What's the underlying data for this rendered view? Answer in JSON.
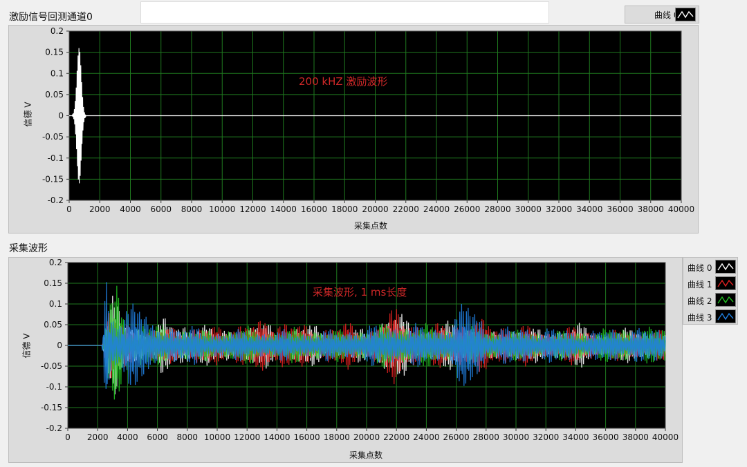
{
  "top_chart": {
    "title": "激励信号回测通道0",
    "ylabel": "信德 V",
    "xlabel": "采集点数",
    "annotation": "200 kHZ 激励波形",
    "legend": [
      {
        "label": "曲线 0",
        "color": "#ffffff"
      }
    ]
  },
  "bottom_chart": {
    "title": "采集波形",
    "ylabel": "信德 V",
    "xlabel": "采集点数",
    "annotation": "采集波形, 1 ms长度",
    "legend": [
      {
        "label": "曲线 0",
        "color": "#ffffff"
      },
      {
        "label": "曲线 1",
        "color": "#e02020"
      },
      {
        "label": "曲线 2",
        "color": "#20c020"
      },
      {
        "label": "曲线 3",
        "color": "#2080e0"
      }
    ]
  },
  "chart_data": [
    {
      "type": "line",
      "title": "激励信号回测通道0",
      "xlabel": "采集点数",
      "ylabel": "信德 V",
      "xlim": [
        0,
        40000
      ],
      "ylim": [
        -0.2,
        0.2
      ],
      "x_ticks": [
        "0",
        "2000",
        "4000",
        "6000",
        "8000",
        "10000",
        "12000",
        "14000",
        "16000",
        "18000",
        "20000",
        "22000",
        "24000",
        "26000",
        "28000",
        "30000",
        "32000",
        "34000",
        "36000",
        "38000",
        "40000"
      ],
      "y_ticks": [
        "0.2",
        "0.15",
        "0.1",
        "0.05",
        "0",
        "-0.05",
        "-0.1",
        "-0.15",
        "-0.2"
      ],
      "grid": true,
      "legend_position": "top-right",
      "series": [
        {
          "name": "曲线 0",
          "color": "#ffffff",
          "burst": {
            "start": 200,
            "end": 1100,
            "peak": 0.185,
            "peak_at": 650
          },
          "after_burst": 0
        }
      ]
    },
    {
      "type": "line",
      "title": "采集波形",
      "xlabel": "采集点数",
      "ylabel": "信德 V",
      "xlim": [
        0,
        40000
      ],
      "ylim": [
        -0.2,
        0.2
      ],
      "x_ticks": [
        "0",
        "2000",
        "4000",
        "6000",
        "8000",
        "10000",
        "12000",
        "14000",
        "16000",
        "18000",
        "20000",
        "22000",
        "24000",
        "26000",
        "28000",
        "30000",
        "32000",
        "34000",
        "36000",
        "38000",
        "40000"
      ],
      "y_ticks": [
        "0.2",
        "0.15",
        "0.1",
        "0.05",
        "0",
        "-0.05",
        "-0.1",
        "-0.15",
        "-0.2"
      ],
      "grid": true,
      "legend_position": "right",
      "signal_start": 2300,
      "series": [
        {
          "name": "曲线 0",
          "color": "#ffffff",
          "envelope": [
            [
              2300,
              0
            ],
            [
              2700,
              0.14
            ],
            [
              3000,
              0.17
            ],
            [
              3600,
              0.06
            ],
            [
              4600,
              0.05
            ],
            [
              5600,
              0.03
            ],
            [
              6300,
              0.08
            ],
            [
              7400,
              0.05
            ],
            [
              8700,
              0.07
            ],
            [
              10000,
              0.04
            ],
            [
              12400,
              0.05
            ],
            [
              13300,
              0.07
            ],
            [
              14000,
              0.03
            ],
            [
              16200,
              0.06
            ],
            [
              18000,
              0.03
            ],
            [
              20000,
              0.05
            ],
            [
              22000,
              0.09
            ],
            [
              24000,
              0.04
            ],
            [
              26000,
              0.07
            ],
            [
              28000,
              0.03
            ],
            [
              30000,
              0.05
            ],
            [
              32000,
              0.04
            ],
            [
              34000,
              0.06
            ],
            [
              36000,
              0.03
            ],
            [
              38000,
              0.05
            ],
            [
              40000,
              0.03
            ]
          ]
        },
        {
          "name": "曲线 1",
          "color": "#e02020",
          "envelope": [
            [
              2300,
              0
            ],
            [
              2800,
              0.1
            ],
            [
              3400,
              0.07
            ],
            [
              5000,
              0.04
            ],
            [
              7000,
              0.05
            ],
            [
              9600,
              0.05
            ],
            [
              10800,
              0.06
            ],
            [
              12600,
              0.06
            ],
            [
              13600,
              0.08
            ],
            [
              16100,
              0.05
            ],
            [
              18800,
              0.06
            ],
            [
              20000,
              0.04
            ],
            [
              22000,
              0.1
            ],
            [
              24000,
              0.05
            ],
            [
              26500,
              0.07
            ],
            [
              29600,
              0.06
            ],
            [
              32000,
              0.04
            ],
            [
              34000,
              0.05
            ],
            [
              36000,
              0.04
            ],
            [
              40000,
              0.04
            ]
          ]
        },
        {
          "name": "曲线 2",
          "color": "#20c020",
          "envelope": [
            [
              2300,
              0
            ],
            [
              2700,
              0.12
            ],
            [
              3300,
              0.16
            ],
            [
              4000,
              0.06
            ],
            [
              5000,
              0.06
            ],
            [
              7000,
              0.05
            ],
            [
              9000,
              0.04
            ],
            [
              12000,
              0.05
            ],
            [
              14000,
              0.04
            ],
            [
              16000,
              0.05
            ],
            [
              18000,
              0.04
            ],
            [
              20000,
              0.05
            ],
            [
              22000,
              0.06
            ],
            [
              26000,
              0.05
            ],
            [
              30000,
              0.04
            ],
            [
              34000,
              0.04
            ],
            [
              38000,
              0.05
            ],
            [
              40000,
              0.05
            ]
          ]
        },
        {
          "name": "曲线 3",
          "color": "#2080e0",
          "envelope": [
            [
              2300,
              0
            ],
            [
              2550,
              0.18
            ],
            [
              2800,
              0.08
            ],
            [
              4600,
              0.15
            ],
            [
              5500,
              0.05
            ],
            [
              6400,
              0.06
            ],
            [
              10000,
              0.04
            ],
            [
              14000,
              0.04
            ],
            [
              18000,
              0.04
            ],
            [
              22000,
              0.06
            ],
            [
              25000,
              0.05
            ],
            [
              27000,
              0.13
            ],
            [
              28000,
              0.05
            ],
            [
              31000,
              0.05
            ],
            [
              35000,
              0.04
            ],
            [
              38000,
              0.05
            ],
            [
              40000,
              0.04
            ]
          ]
        }
      ]
    }
  ]
}
